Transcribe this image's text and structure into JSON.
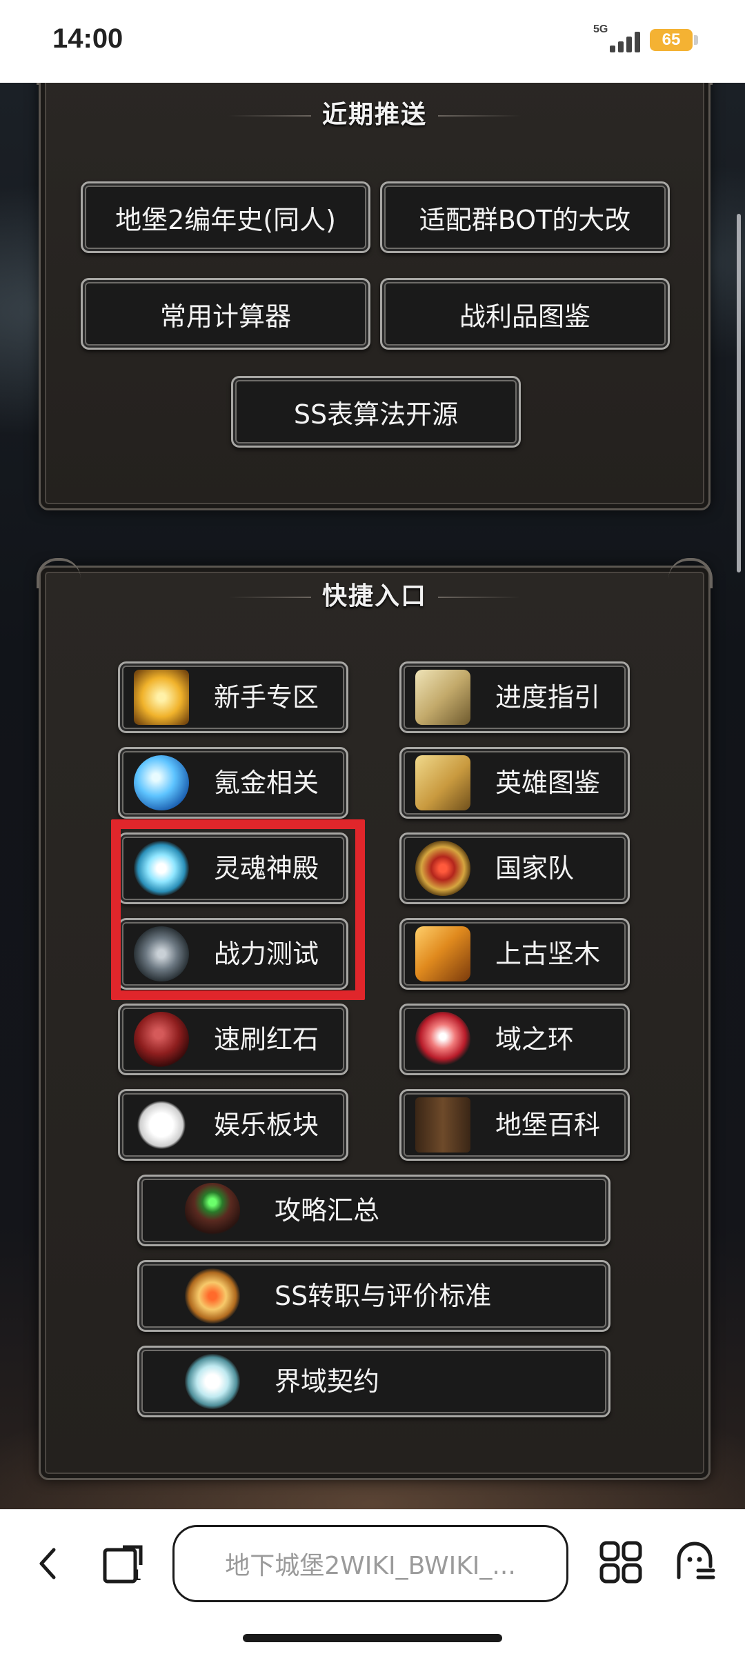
{
  "status": {
    "time": "14:00",
    "network": "5G",
    "battery": "65"
  },
  "recent": {
    "title": "近期推送",
    "buttons": [
      "地堡2编年史(同人)",
      "适配群BOT的大改",
      "常用计算器",
      "战利品图鉴",
      "SS表算法开源"
    ]
  },
  "quick": {
    "title": "快捷入口",
    "left": [
      {
        "label": "新手专区",
        "icon": "golden-book-icon"
      },
      {
        "label": "氪金相关",
        "icon": "blue-crystal-icon"
      },
      {
        "label": "灵魂神殿",
        "icon": "soul-orb-icon"
      },
      {
        "label": "战力测试",
        "icon": "crossed-swords-icon"
      },
      {
        "label": "速刷红石",
        "icon": "red-stone-icon"
      },
      {
        "label": "娱乐板块",
        "icon": "mask-icon"
      }
    ],
    "right": [
      {
        "label": "进度指引",
        "icon": "scroll-icon"
      },
      {
        "label": "英雄图鉴",
        "icon": "map-scroll-icon"
      },
      {
        "label": "国家队",
        "icon": "crest-icon"
      },
      {
        "label": "上古坚木",
        "icon": "wood-log-icon"
      },
      {
        "label": "域之环",
        "icon": "red-gem-icon"
      },
      {
        "label": "地堡百科",
        "icon": "tome-icon"
      }
    ],
    "wide": [
      {
        "label": "攻略汇总",
        "icon": "cauldron-icon"
      },
      {
        "label": "SS转职与评价标准",
        "icon": "gold-emblem-icon"
      },
      {
        "label": "界域契约",
        "icon": "white-orb-icon"
      }
    ]
  },
  "browser": {
    "url": "地下城堡2WIKI_BWIKI_..."
  }
}
